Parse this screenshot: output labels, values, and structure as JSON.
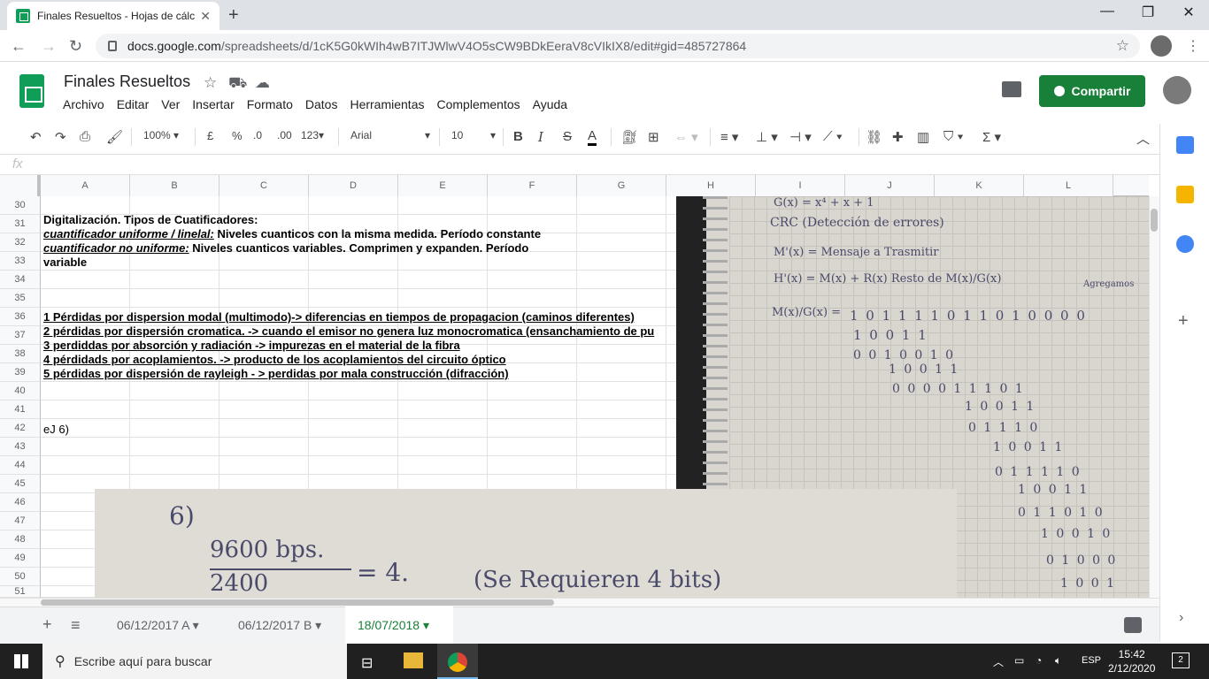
{
  "browser": {
    "tab_title": "Finales Resueltos - Hojas de cálc",
    "url_host": "docs.google.com",
    "url_path": "/spreadsheets/d/1cK5G0kWIh4wB7ITJWlwV4O5sCW9BDkEeraV8cVIkIX8/edit#gid=485727864"
  },
  "doc": {
    "title": "Finales Resueltos",
    "menu": [
      "Archivo",
      "Editar",
      "Ver",
      "Insertar",
      "Formato",
      "Datos",
      "Herramientas",
      "Complementos",
      "Ayuda"
    ],
    "share_label": "Compartir"
  },
  "toolbar": {
    "zoom": "100%",
    "currency": "£",
    "percent": "%",
    "dec_less": ".0",
    "dec_more": ".00",
    "format": "123",
    "font": "Arial",
    "size": "10",
    "bold": "B",
    "italic": "I",
    "strike": "S",
    "text_color": "A"
  },
  "formula_bar": {
    "fx": "fx",
    "value": ""
  },
  "columns": [
    "A",
    "B",
    "C",
    "D",
    "E",
    "F",
    "G",
    "H",
    "I",
    "J",
    "K",
    "L"
  ],
  "rows": [
    "30",
    "31",
    "32",
    "33",
    "34",
    "35",
    "36",
    "37",
    "38",
    "39",
    "40",
    "41",
    "42",
    "43",
    "44",
    "45",
    "46",
    "47",
    "48",
    "49",
    "50",
    "51"
  ],
  "cells": {
    "r31": "Digitalización. Tipos de Cuatificadores:",
    "r32a": "cuantificador uniforme / linelal:",
    "r32b": " Niveles cuanticos con la misma medida. Período constante",
    "r33a": "cuantificador no uniforme:",
    "r33b": " Niveles cuanticos variables. Comprimen y expanden. Período",
    "r33c": "variable",
    "r36": "1 Pérdidas por dispersion modal (multimodo)-> diferencias en tiempos de propagacion (caminos diferentes)",
    "r37": "2 pérdidas por dispersión cromatica. -> cuando el emisor no genera luz monocromatica (ensanchamiento de pu",
    "r38": "3 perdiddas por absorción y radiación -> impurezas en el material de la fibra",
    "r39": "4 pérdidads por acoplamientos. -> producto de los acoplamientos del circuito óptico",
    "r40": "5 pérdidas por dispersión de rayleigh - > perdidas por mala construcción (difracción)",
    "r42": "eJ 6)"
  },
  "photo1": {
    "lines": [
      "G(x) = x⁴ + x + 1",
      "CRC (Detección de errores)",
      "M'(x) = Mensaje a Trasmitir",
      "H'(x) = M(x) + R(x)  Resto de M(x)/G(x)",
      "M(x)/G(x) =",
      "1 0 1 1 1 1 0 1 1 0 1 0 0 0 0",
      "1 0 0 1 1",
      "0 0 1 0 0 1 0",
      "1 0 0 1 1",
      "0 0 0 0 1 1 1 0 1",
      "1 0 0 1 1",
      "0 1 1 1 0",
      "1 0 0 1 1",
      "0 1 1 1 1 0",
      "1 0 0 1 1",
      "0 1 1 0 1 0",
      "1 0 0 1 0",
      "0 1 0 0 0",
      "1 0 0 1"
    ],
    "margin": "Agregamos"
  },
  "photo2": {
    "label": "6)",
    "numerator": "9600 bps.",
    "denominator": "2400",
    "result": "= 4.",
    "note": "(Se Requieren 4 bits)"
  },
  "sheet_tabs": [
    "06/12/2017 A",
    "06/12/2017 B",
    "18/07/2018"
  ],
  "taskbar": {
    "search_placeholder": "Escribe aquí para buscar",
    "lang": "ESP",
    "time": "15:42",
    "date": "2/12/2020",
    "notif_count": "2"
  },
  "colors": {
    "accent": "#188038",
    "sheets_green": "#0f9d58"
  }
}
